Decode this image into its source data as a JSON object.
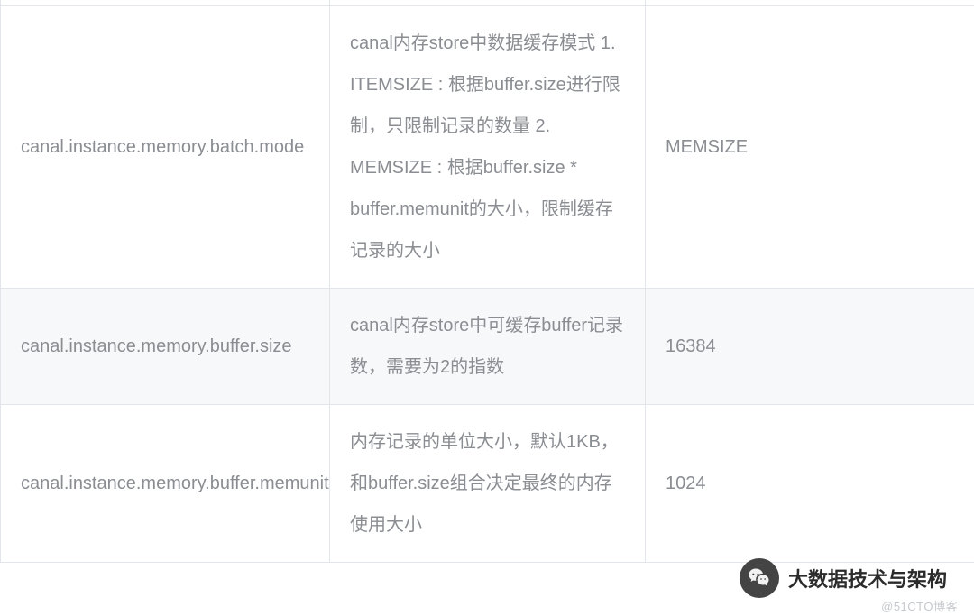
{
  "rows": [
    {
      "key": "canal.instance.memory.batch.mode",
      "desc": "canal内存store中数据缓存模式\n1. ITEMSIZE : 根据buffer.size进行限制，只限制记录的数量\n2. MEMSIZE : 根据buffer.size * buffer.memunit的大小，限制缓存记录的大小",
      "default": "MEMSIZE"
    },
    {
      "key": "canal.instance.memory.buffer.size",
      "desc": "canal内存store中可缓存buffer记录数，需要为2的指数",
      "default": "16384"
    },
    {
      "key": "canal.instance.memory.buffer.memunit",
      "desc": "内存记录的单位大小，默认1KB，和buffer.size组合决定最终的内存使用大小",
      "default": "1024"
    }
  ],
  "wechat_label": "大数据技术与架构",
  "watermark": "@51CTO博客"
}
